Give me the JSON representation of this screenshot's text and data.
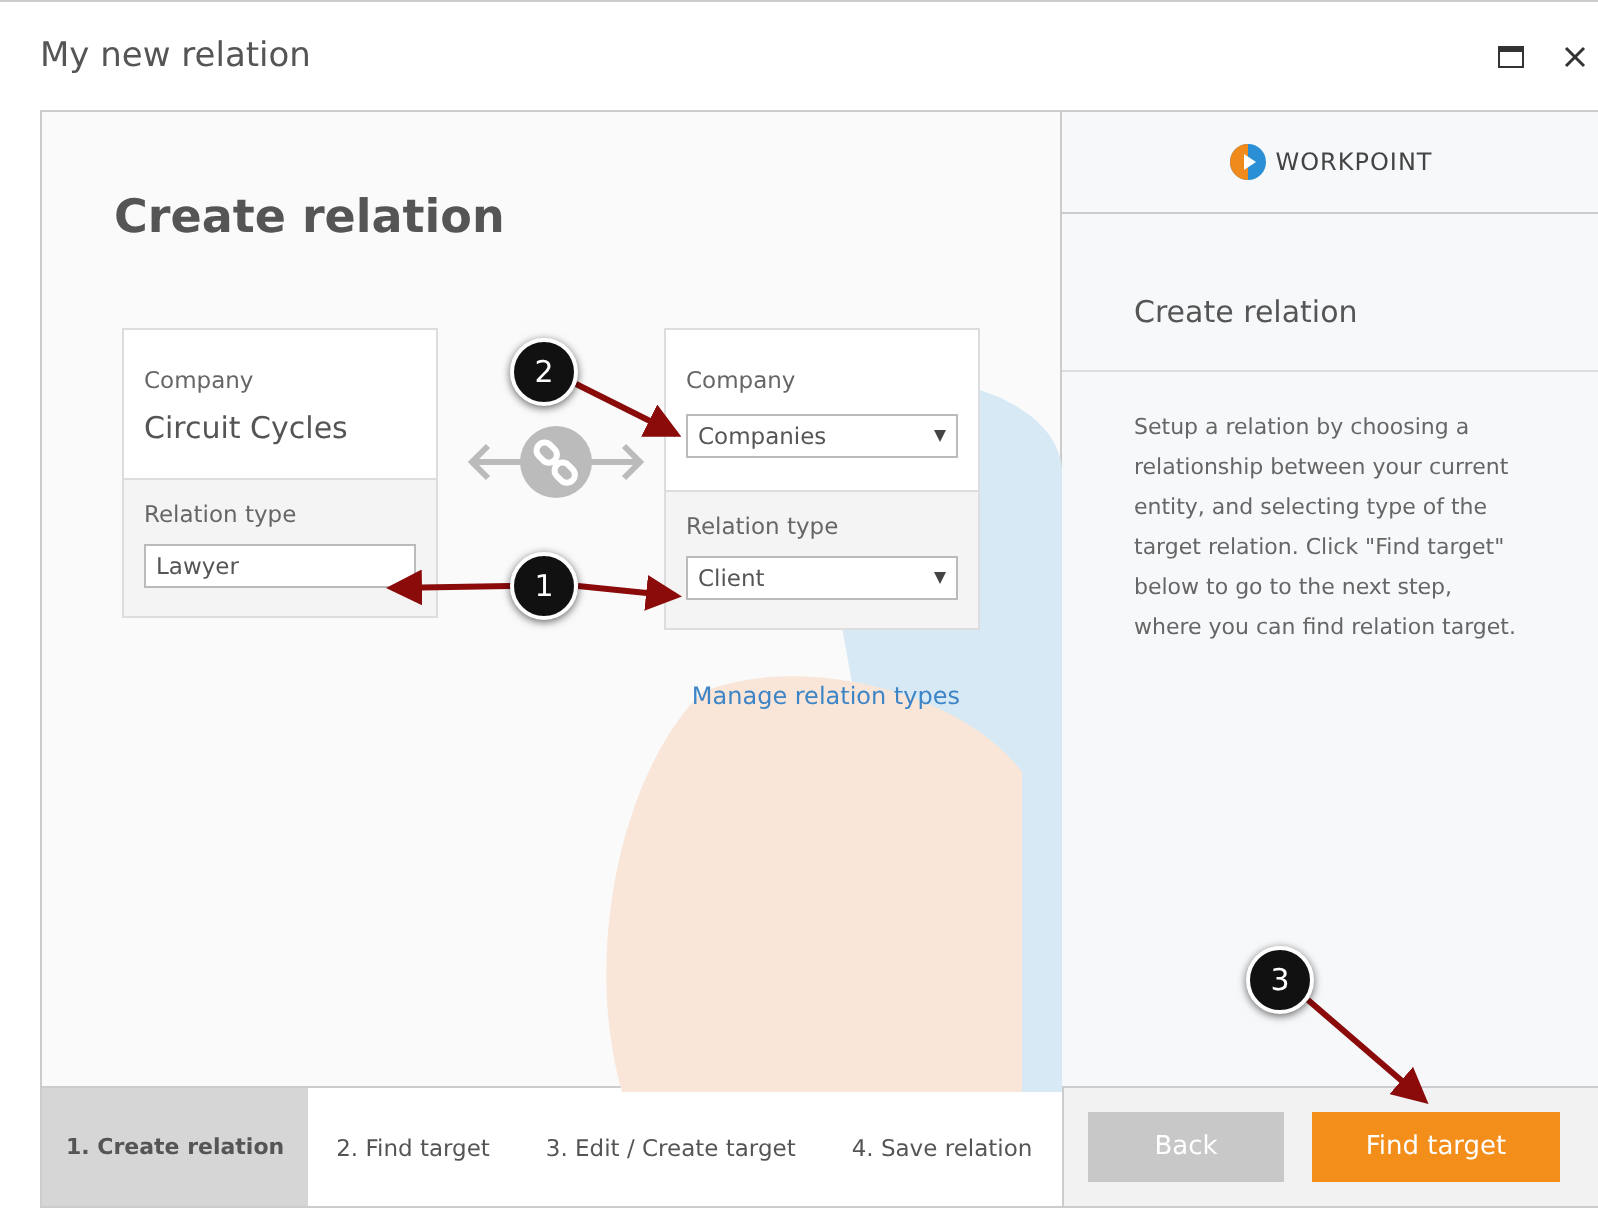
{
  "window": {
    "title": "My new relation"
  },
  "main": {
    "heading": "Create relation",
    "source": {
      "entity_label": "Company",
      "entity_name": "Circuit Cycles",
      "relation_label": "Relation type",
      "relation_value": "Lawyer"
    },
    "target": {
      "entity_label": "Company",
      "entity_value": "Companies",
      "relation_label": "Relation type",
      "relation_value": "Client"
    },
    "manage_link": "Manage relation types"
  },
  "side": {
    "brand": "WORKPOINT",
    "title": "Create relation",
    "description": "Setup a relation by choosing a relationship between your current entity, and selecting type of the target relation. Click \"Find target\" below to go to the next step, where you can find relation target."
  },
  "steps": [
    {
      "label": "1. Create relation",
      "selected": true
    },
    {
      "label": "2. Find target",
      "selected": false
    },
    {
      "label": "3. Edit / Create target",
      "selected": false
    },
    {
      "label": "4. Save relation",
      "selected": false
    }
  ],
  "buttons": [
    {
      "label": "Back",
      "kind": "secondary"
    },
    {
      "label": "Find target",
      "kind": "primary"
    }
  ],
  "callouts": [
    {
      "label": "2"
    },
    {
      "label": "1"
    },
    {
      "label": "3"
    }
  ]
}
